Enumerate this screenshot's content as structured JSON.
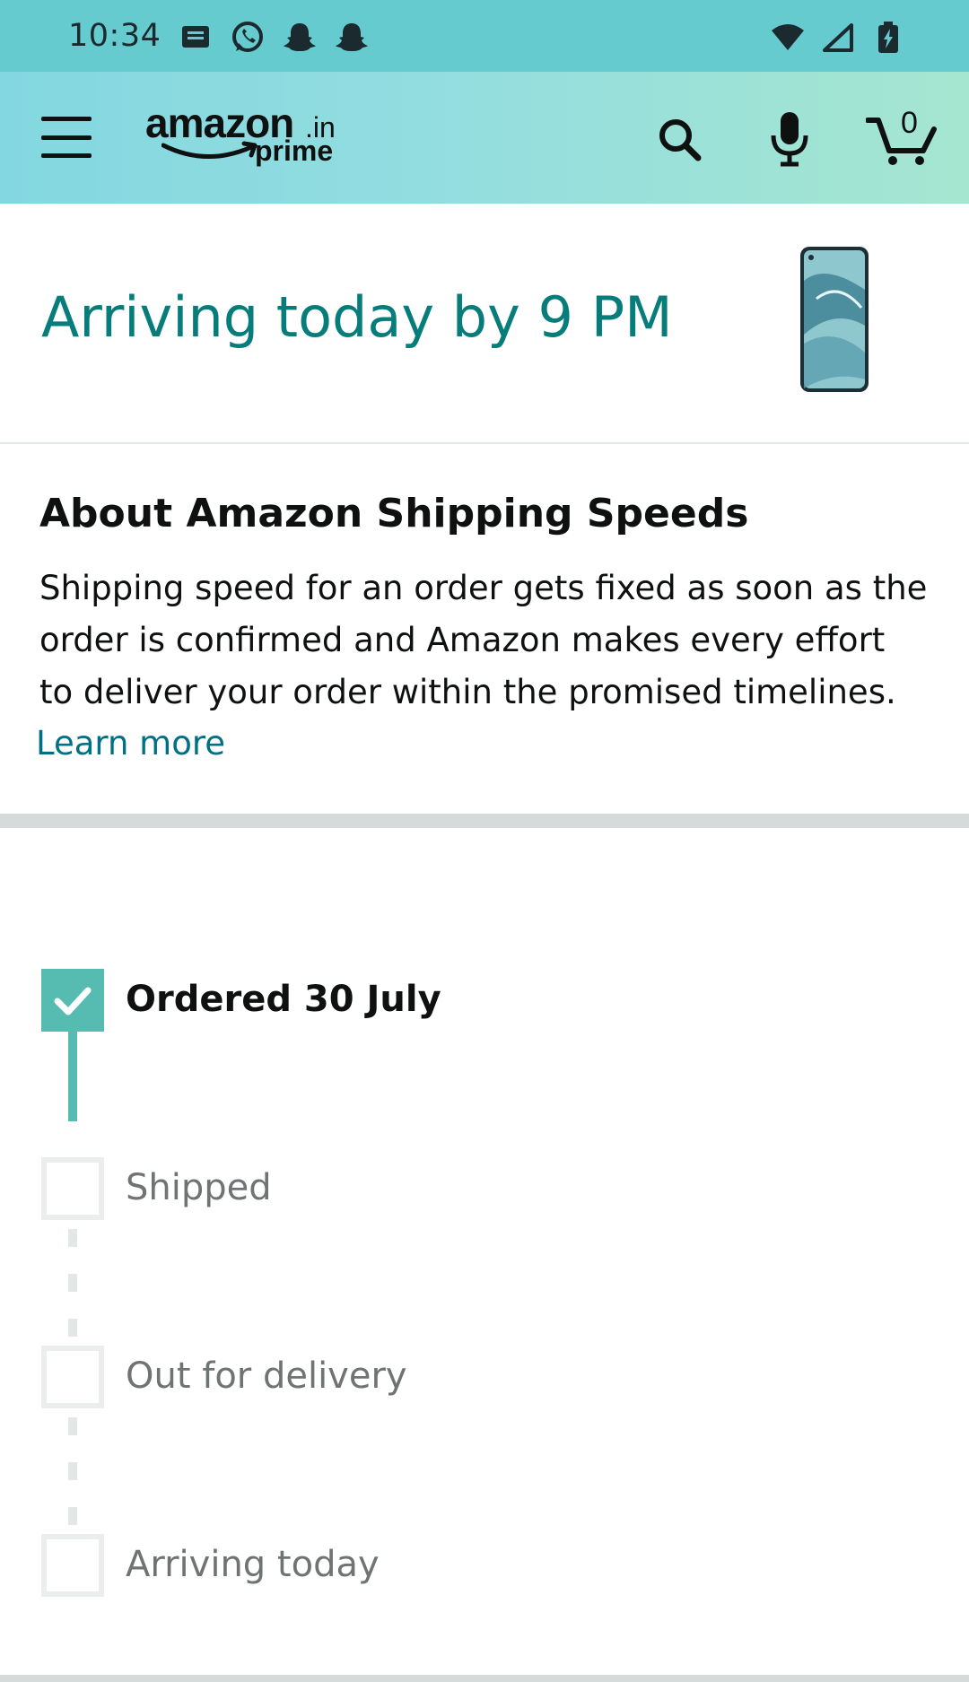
{
  "status_bar": {
    "time": "10:34",
    "left_icons": [
      "message-icon",
      "whatsapp-icon",
      "snapchat-icon",
      "snapchat-icon"
    ],
    "right_icons": [
      "wifi-icon",
      "signal-icon",
      "battery-charging-icon"
    ]
  },
  "header": {
    "logo": {
      "word": "amazon",
      "suffix": ".in",
      "tier": "prime"
    },
    "cart_count": "0",
    "icons": [
      "menu-icon",
      "search-icon",
      "microphone-icon",
      "cart-icon"
    ]
  },
  "arrival": {
    "title": "Arriving today by 9 PM",
    "product_image": "smartphone-thumbnail"
  },
  "about": {
    "title": "About Amazon Shipping Speeds",
    "body": "Shipping speed for an order gets fixed as soon as the order is confirmed and Amazon makes every effort to deliver your order within the promised timelines.",
    "link": "Learn more"
  },
  "tracker": {
    "steps": [
      {
        "label": "Ordered 30 July",
        "done": true
      },
      {
        "label": "Shipped",
        "done": false
      },
      {
        "label": "Out for delivery",
        "done": false
      },
      {
        "label": "Arriving today",
        "done": false
      }
    ]
  },
  "colors": {
    "status_bar": "#66cbcf",
    "accent_teal": "#067d7a",
    "step_done": "#56bbb1",
    "link": "#007185"
  }
}
